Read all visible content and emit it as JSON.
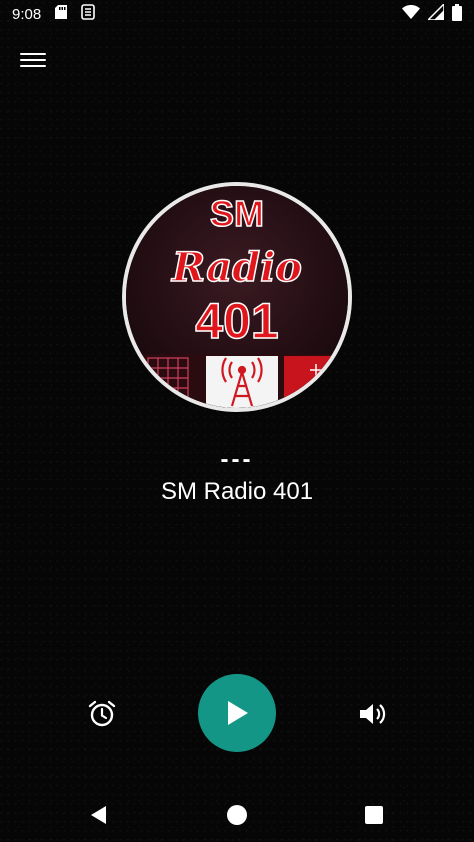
{
  "status_bar": {
    "time": "9:08",
    "left_icons": [
      "sd-card-icon",
      "cast-icon"
    ],
    "right_icons": [
      "wifi-icon",
      "signal-icon",
      "battery-icon"
    ]
  },
  "header": {
    "menu_icon": "hamburger-menu-icon"
  },
  "artwork": {
    "line1": "SM",
    "line2": "Radio",
    "line3": "401"
  },
  "player": {
    "now_playing": "---",
    "station_name": "SM Radio 401",
    "accent_color": "#139686"
  },
  "controls": {
    "left_icon": "alarm-icon",
    "center_icon": "play-icon",
    "right_icon": "volume-icon"
  },
  "nav_bar": {
    "icons": [
      "back-icon",
      "home-icon",
      "recents-icon"
    ]
  }
}
